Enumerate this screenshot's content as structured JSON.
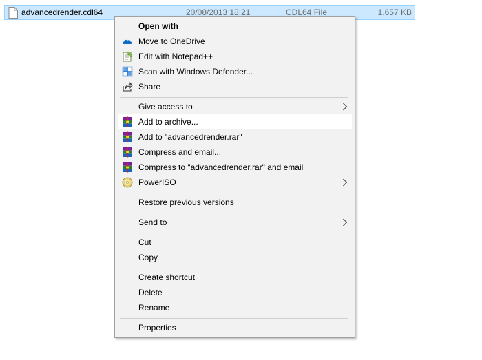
{
  "file_row": {
    "name": "advancedrender.cdl64",
    "date_modified": "20/08/2013 18:21",
    "type": "CDL64 File",
    "size": "1.657 KB",
    "icon": "document-icon"
  },
  "context_menu": {
    "items": [
      {
        "label": "Open with",
        "bold": true
      },
      {
        "label": "Move to OneDrive",
        "icon": "onedrive-icon"
      },
      {
        "label": "Edit with Notepad++",
        "icon": "notepad-plus-plus-icon"
      },
      {
        "label": "Scan with Windows Defender...",
        "icon": "windows-defender-icon"
      },
      {
        "label": "Share",
        "icon": "share-icon"
      },
      {
        "label": "Give access to",
        "submenu": true
      },
      {
        "label": "Add to archive...",
        "icon": "winrar-icon",
        "highlighted": true
      },
      {
        "label": "Add to \"advancedrender.rar\"",
        "icon": "winrar-icon"
      },
      {
        "label": "Compress and email...",
        "icon": "winrar-icon"
      },
      {
        "label": "Compress to \"advancedrender.rar\" and email",
        "icon": "winrar-icon"
      },
      {
        "label": "PowerISO",
        "icon": "poweriso-icon",
        "submenu": true
      },
      {
        "label": "Restore previous versions"
      },
      {
        "label": "Send to",
        "submenu": true
      },
      {
        "label": "Cut"
      },
      {
        "label": "Copy"
      },
      {
        "label": "Create shortcut"
      },
      {
        "label": "Delete"
      },
      {
        "label": "Rename"
      },
      {
        "label": "Properties"
      }
    ]
  },
  "colors": {
    "selection_background": "#cce8ff",
    "menu_background": "#f2f2f2",
    "hover_background": "#ffffff"
  }
}
